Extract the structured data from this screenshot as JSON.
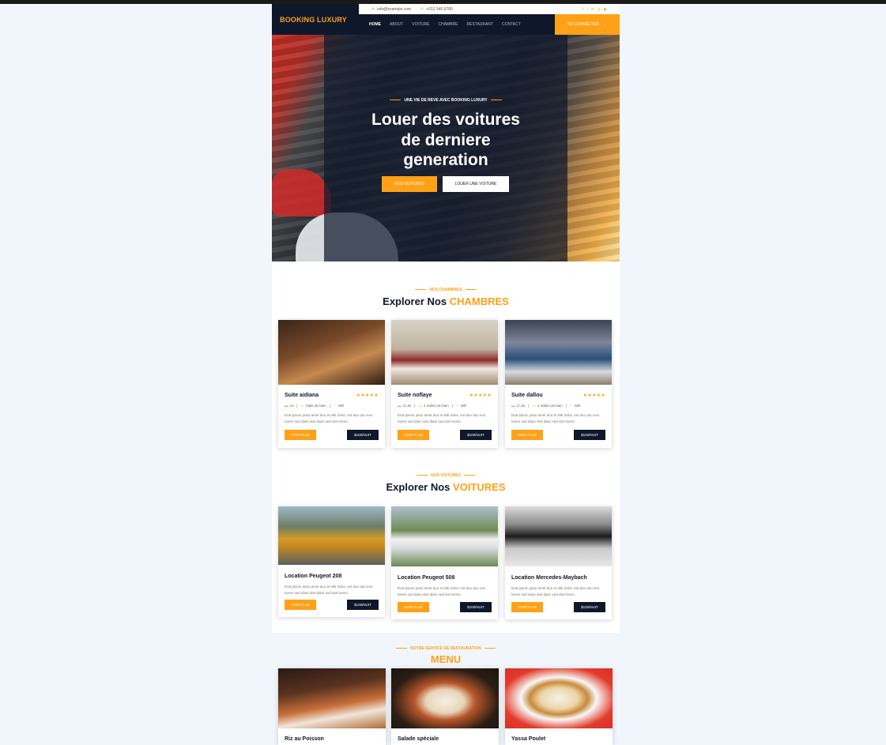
{
  "header": {
    "brand": "BOOKING LUXURY",
    "email": "info@example.com",
    "phone": "+012 345 6789",
    "social_icons": [
      "facebook-icon",
      "twitter-icon",
      "linkedin-icon",
      "instagram-icon",
      "youtube-icon"
    ],
    "nav": [
      "HOME",
      "ABOUT",
      "VOITURE",
      "CHAMBRE",
      "RESTAURANT",
      "CONTACT"
    ],
    "login_label": "SE CONNECTER"
  },
  "hero": {
    "subtitle": "UNE VIE DE REVE AVEC BOOKING LUXURY",
    "title_lines": [
      "Louer des voitures",
      "de derniere",
      "generation"
    ],
    "btn_primary": "NOS VOITURES",
    "btn_secondary": "LOUER UNE VOITURE"
  },
  "rooms": {
    "eyebrow": "NOS CHAMBRES",
    "title_prefix": "Explorer Nos",
    "title_highlight": "CHAMBRES",
    "cards": [
      {
        "name": "Suite aidiana",
        "stars": "★★★★★",
        "feats": [
          "Lit",
          "Salle de bain",
          "Wifi"
        ],
        "desc": "Erat ipsum justo amet duo et elitr dolor, est duo duo eos lorem sed diam stet diam sed stet lorem.",
        "more": "VOIR PLUS",
        "price": "$100/NUIT"
      },
      {
        "name": "Suite noflaye",
        "stars": "★★★★★",
        "feats": [
          "3 Lits",
          "2 Salles de bain",
          "Wifi"
        ],
        "desc": "Erat ipsum justo amet duo et elitr dolor, est duo duo eos lorem sed diam stet diam sed stet lorem.",
        "more": "VOIR PLUS",
        "price": "$100/NUIT"
      },
      {
        "name": "Suite dallou",
        "stars": "★★★★★",
        "feats": [
          "2 Lits",
          "2 Salles de bain",
          "Wifi"
        ],
        "desc": "Erat ipsum justo amet duo et elitr dolor, est duo duo eos lorem sed diam stet diam sed stet lorem.",
        "more": "VOIR PLUS",
        "price": "$100/NUIT"
      }
    ]
  },
  "cars": {
    "eyebrow": "NOS VOITURES",
    "title_prefix": "Explorer Nos",
    "title_highlight": "VOITURES",
    "cards": [
      {
        "name": "Location Peugeot 208",
        "desc": "Erat ipsum justo amet duo et elitr dolor, est duo duo eos lorem sed diam stet diam sed stet lorem.",
        "more": "VOIR PLUS",
        "price": "$100/NUIT"
      },
      {
        "name": "Location Peugeot 508",
        "desc": "Erat ipsum justo amet duo et elitr dolor, est duo duo eos lorem sed diam stet diam sed stet lorem.",
        "more": "VOIR PLUS",
        "price": "$100/NUIT"
      },
      {
        "name": "Location Mercedes-Maybach",
        "desc": "Erat ipsum justo amet duo et elitr dolor, est duo duo eos lorem sed diam stet diam sed stet lorem.",
        "more": "VOIR PLUS",
        "price": "$100/NUIT"
      }
    ]
  },
  "menu": {
    "eyebrow": "NOTRE SERVICE DE RESTAURATION",
    "title": "MENU",
    "items": [
      "Riz au Poisson",
      "Salade spéciale",
      "Yassa Poulet"
    ]
  },
  "colors": {
    "accent": "#fea116",
    "dark": "#0f172b",
    "background": "#f1f6fc"
  }
}
